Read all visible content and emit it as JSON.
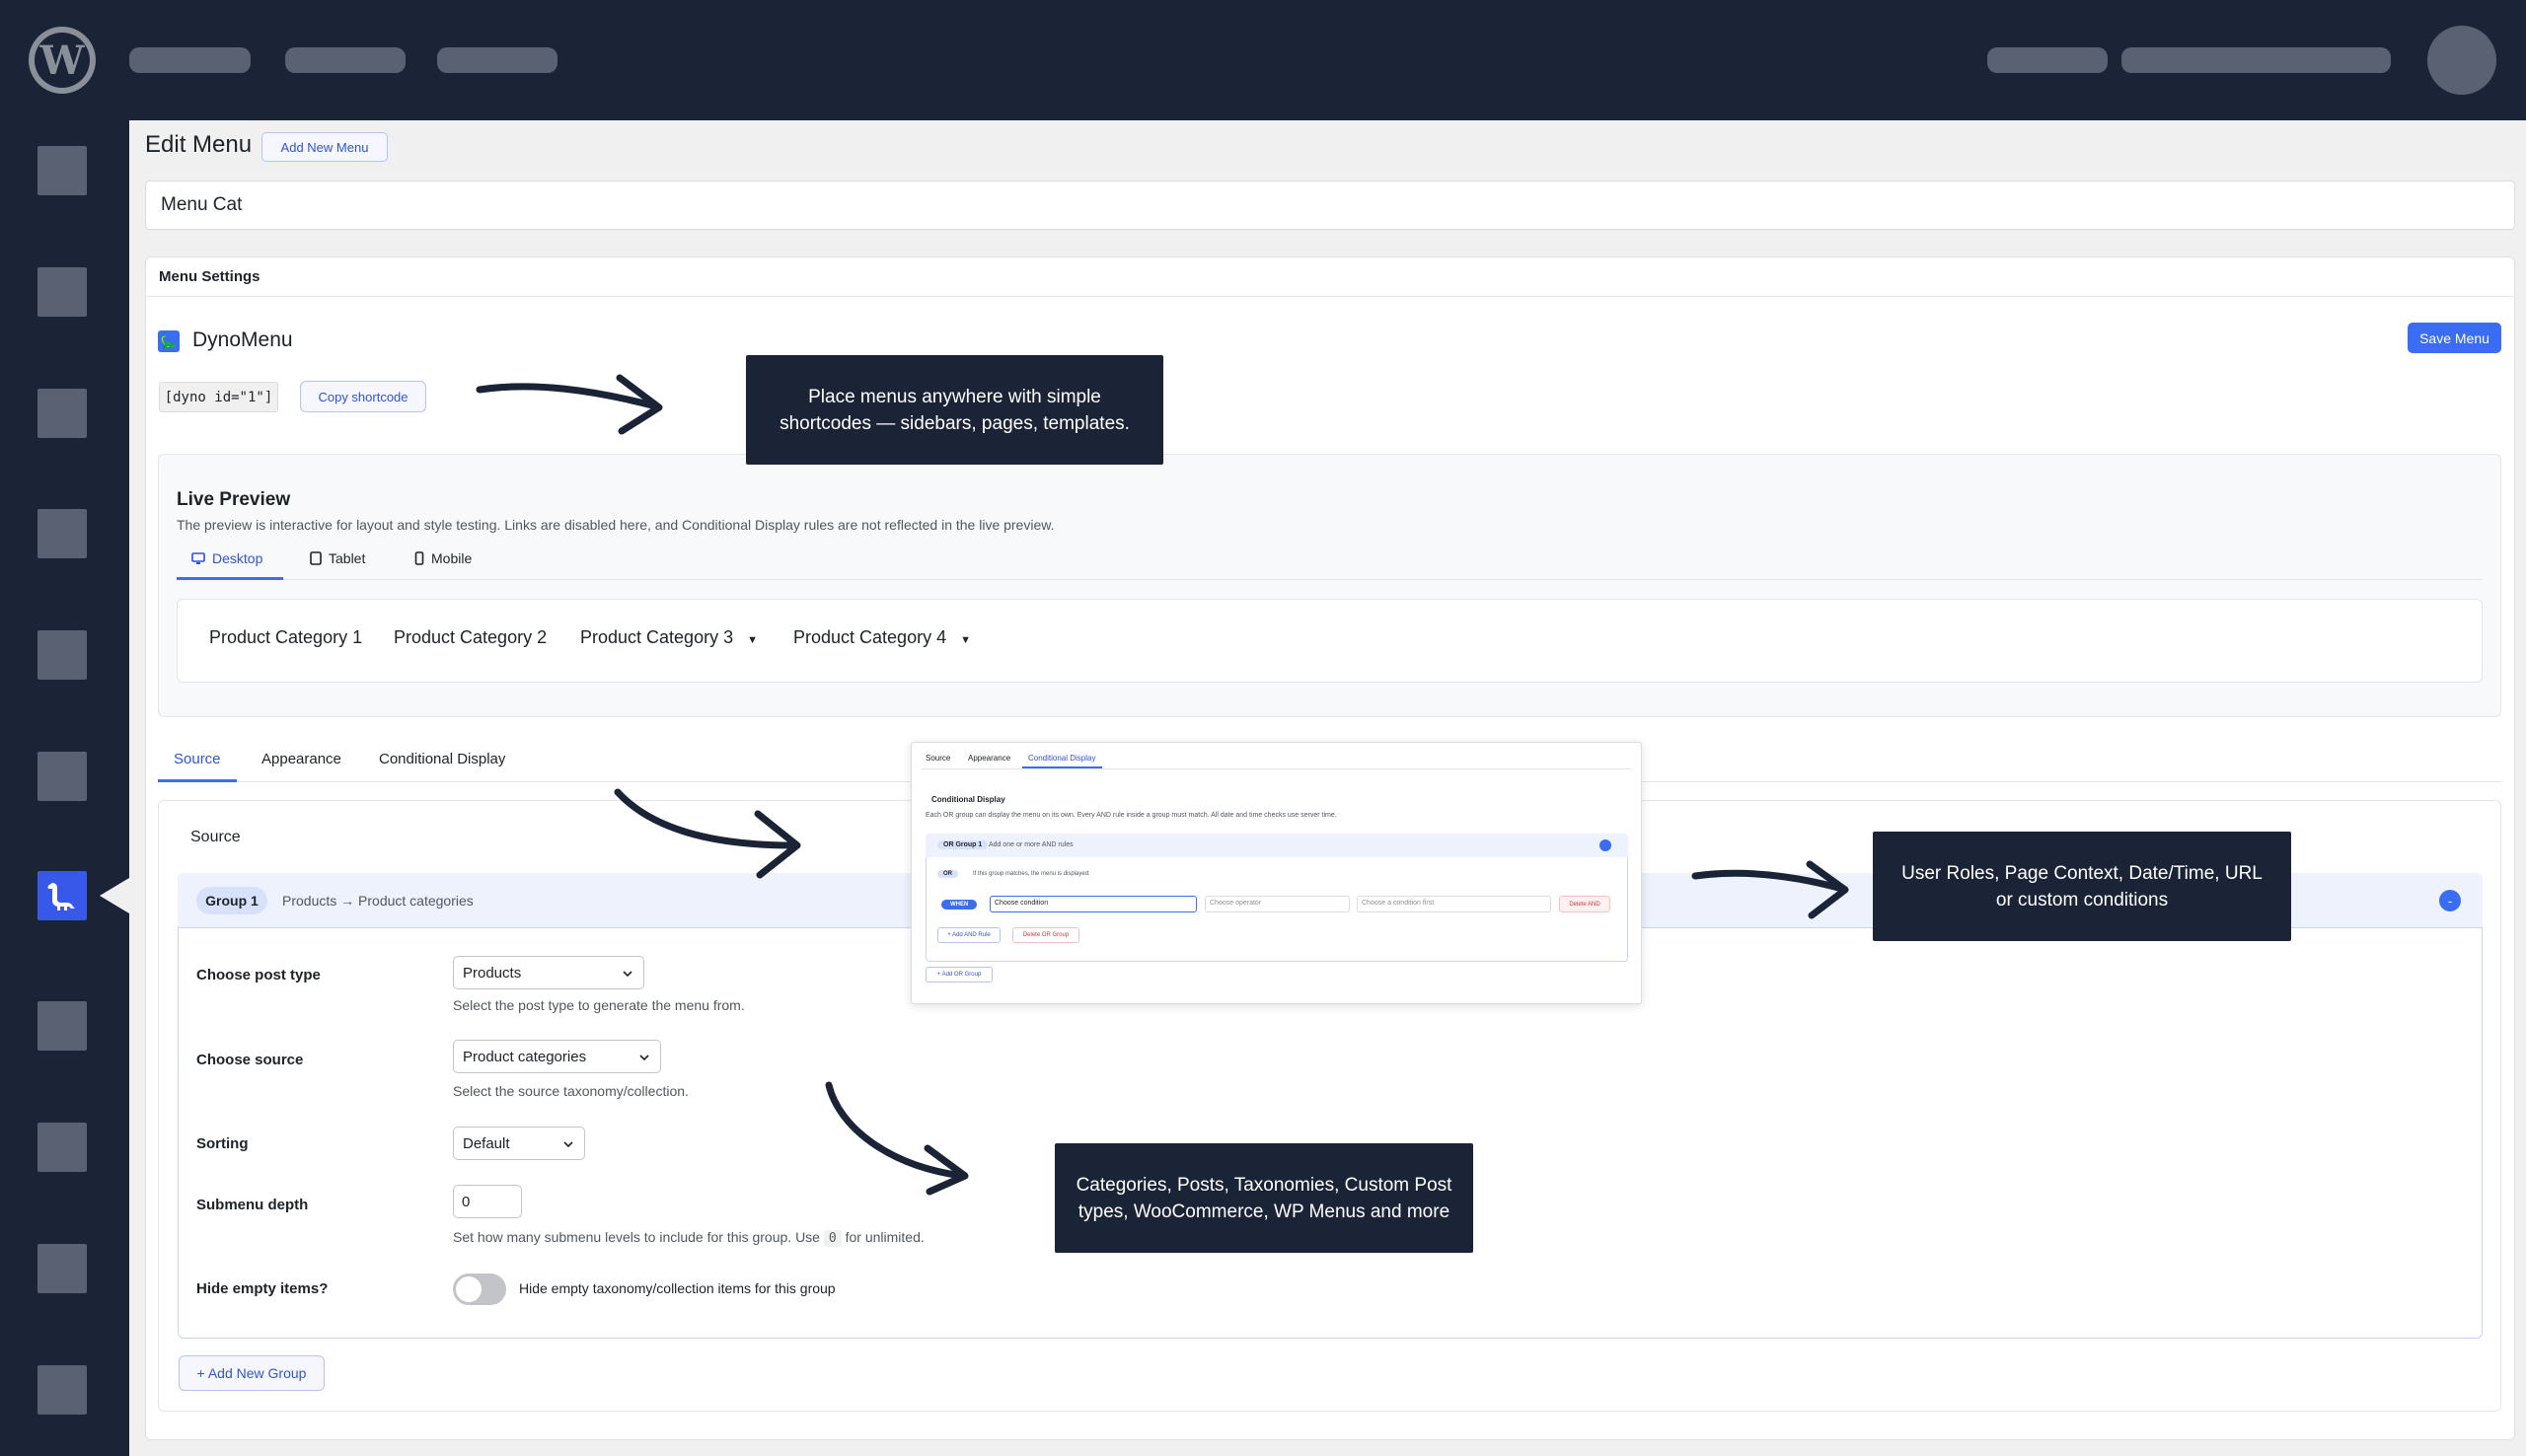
{
  "page": {
    "title": "Edit Menu",
    "add_new_menu": "Add New Menu",
    "menu_name": "Menu Cat"
  },
  "card": {
    "header": "Menu Settings",
    "plugin_name": "DynoMenu",
    "save_button": "Save Menu",
    "shortcode": "[dyno id=\"1\"]",
    "copy_shortcode": "Copy shortcode"
  },
  "callouts": {
    "shortcodes": "Place menus anywhere with simple shortcodes — sidebars, pages, templates.",
    "conditions": "User Roles, Page Context, Date/Time, URL or custom conditions",
    "sources": "Categories, Posts, Taxonomies, Custom Post types, WooCommerce, WP Menus and more"
  },
  "preview": {
    "title": "Live Preview",
    "description": "The preview is interactive for layout and style testing. Links are disabled here, and Conditional Display rules are not reflected in the live preview.",
    "devices": [
      "Desktop",
      "Tablet",
      "Mobile"
    ],
    "active_device": "Desktop",
    "menu_items": [
      {
        "label": "Product Category 1",
        "has_submenu": false
      },
      {
        "label": "Product Category 2",
        "has_submenu": false
      },
      {
        "label": "Product Category 3",
        "has_submenu": true
      },
      {
        "label": "Product Category 4",
        "has_submenu": true
      }
    ]
  },
  "settings_tabs": [
    "Source",
    "Appearance",
    "Conditional Display"
  ],
  "active_tab": "Source",
  "source": {
    "title": "Source",
    "group": {
      "badge": "Group 1",
      "summary": "Products → Product categories",
      "toggle": "-"
    },
    "fields": {
      "post_type": {
        "label": "Choose post type",
        "value": "Products",
        "help": "Select the post type to generate the menu from."
      },
      "source": {
        "label": "Choose source",
        "value": "Product categories",
        "help": "Select the source taxonomy/collection."
      },
      "sorting": {
        "label": "Sorting",
        "value": "Default"
      },
      "depth": {
        "label": "Submenu depth",
        "value": "0",
        "help_before": "Set how many submenu levels to include for this group. Use",
        "help_code": "0",
        "help_after": "for unlimited."
      },
      "hide_empty": {
        "label": "Hide empty items?",
        "toggle_label": "Hide empty taxonomy/collection items for this group",
        "enabled": false
      }
    },
    "add_group": "+ Add New Group"
  },
  "inset": {
    "tabs": [
      "Source",
      "Appearance",
      "Conditional Display"
    ],
    "active_tab": "Conditional Display",
    "title": "Conditional Display",
    "description": "Each OR group can display the menu on its own. Every AND rule inside a group must match. All date and time checks use server time.",
    "or_group_badge": "OR Group 1",
    "or_group_sub": "Add one or more AND rules",
    "or_pill": "OR",
    "or_note": "If this group matches, the menu is displayed:",
    "when_pill": "WHEN",
    "condition_placeholder": "Choose condition",
    "operator_placeholder": "Choose operator",
    "value_placeholder": "Choose a condition first",
    "delete_and": "Delete AND",
    "add_and": "+ Add AND Rule",
    "delete_or": "Delete OR Group",
    "add_or": "+ Add OR Group"
  },
  "colors": {
    "admin_bar": "#1b2437",
    "accent": "#3b6df2",
    "background": "#f0f0f1"
  }
}
